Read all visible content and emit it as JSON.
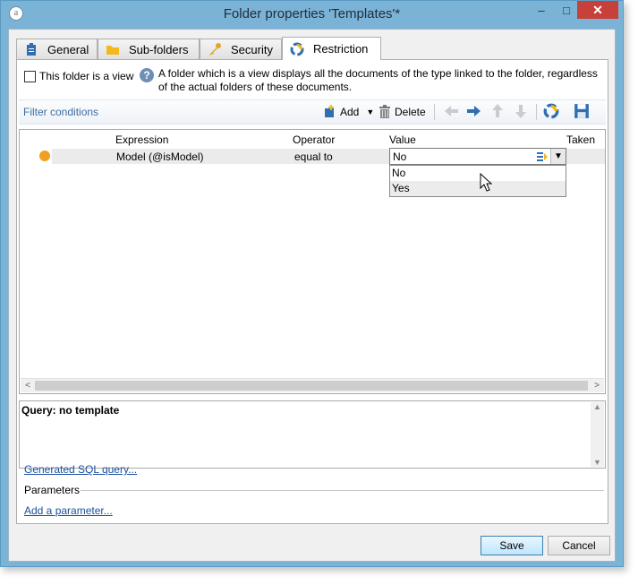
{
  "window": {
    "title": "Folder properties 'Templates'*",
    "minimize": "‒",
    "maximize": "□",
    "close": "✕"
  },
  "tabs": [
    {
      "label": "General",
      "icon": "clipboard-icon"
    },
    {
      "label": "Sub-folders",
      "icon": "folder-icon"
    },
    {
      "label": "Security",
      "icon": "key-icon"
    },
    {
      "label": "Restriction",
      "icon": "restriction-icon",
      "active": true
    }
  ],
  "view": {
    "checkbox_label": "This folder is a view",
    "checked": false,
    "help_text": "A folder which is a view displays all the documents of the type linked to the folder, regardless of the actual folders of these documents."
  },
  "toolbar": {
    "filter_conditions": "Filter conditions",
    "add_label": "Add",
    "delete_label": "Delete"
  },
  "grid": {
    "columns": [
      "Expression",
      "Operator",
      "Value",
      "Taken"
    ],
    "rows": [
      {
        "expression": "Model (@isModel)",
        "operator": "equal to",
        "value": "No"
      }
    ]
  },
  "dropdown": {
    "options": [
      "No",
      "Yes"
    ],
    "hovered": "Yes"
  },
  "query": {
    "text": "Query: no template"
  },
  "links": {
    "sql": "Generated SQL query...",
    "params_label": "Parameters",
    "add_param": "Add a parameter..."
  },
  "buttons": {
    "save": "Save",
    "cancel": "Cancel"
  },
  "colors": {
    "accent": "#3a6ea5",
    "close": "#c7403a",
    "status_dot": "#f0a020"
  }
}
